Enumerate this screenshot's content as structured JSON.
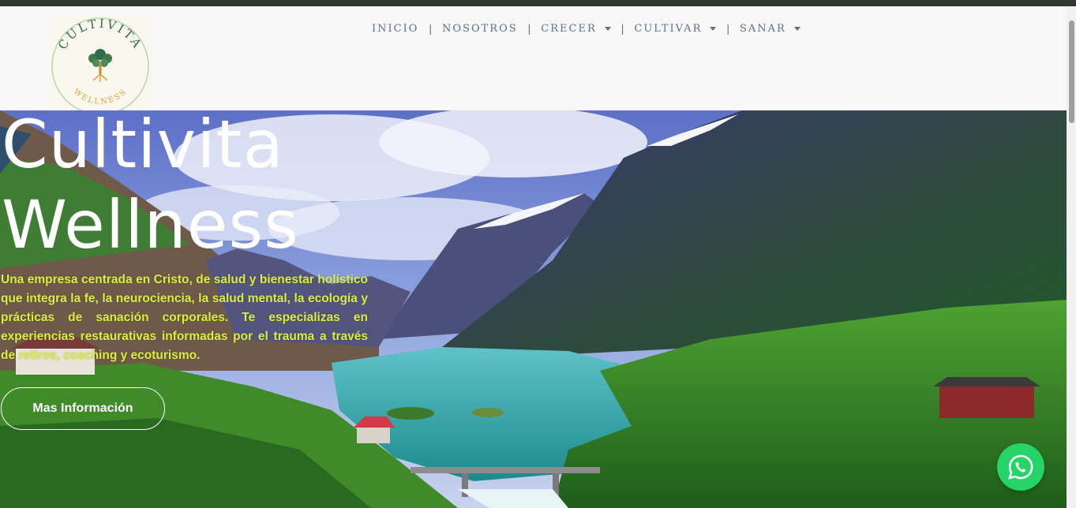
{
  "brand": {
    "logo_word_top": "CULTIVITA",
    "logo_word_bottom": "WELLNESS"
  },
  "nav": {
    "items": [
      {
        "label": "INICIO",
        "has_dropdown": false
      },
      {
        "label": "NOSOTROS",
        "has_dropdown": false
      },
      {
        "label": "CRECER",
        "has_dropdown": true
      },
      {
        "label": "CULTIVAR",
        "has_dropdown": true
      },
      {
        "label": "SANAR",
        "has_dropdown": true
      }
    ],
    "separator": "|"
  },
  "hero": {
    "title_line1": "Cultivita",
    "title_line2": "Wellness",
    "description": "Una empresa centrada en Cristo, de salud y bienestar holístico que integra la fe, la neurociencia, la salud mental, la ecología y prácticas de sanación corporales. Te especializas en experiencias restaurativas informadas por el trauma a través de retiros, coaching y ecoturismo.",
    "cta_label": "Mas Información"
  },
  "floating": {
    "whatsapp_icon": "whatsapp-icon"
  },
  "colors": {
    "nav_text": "#5d6f86",
    "hero_text": "#d9ee3e",
    "whatsapp": "#25d366",
    "topbar": "#2e3a2f"
  }
}
